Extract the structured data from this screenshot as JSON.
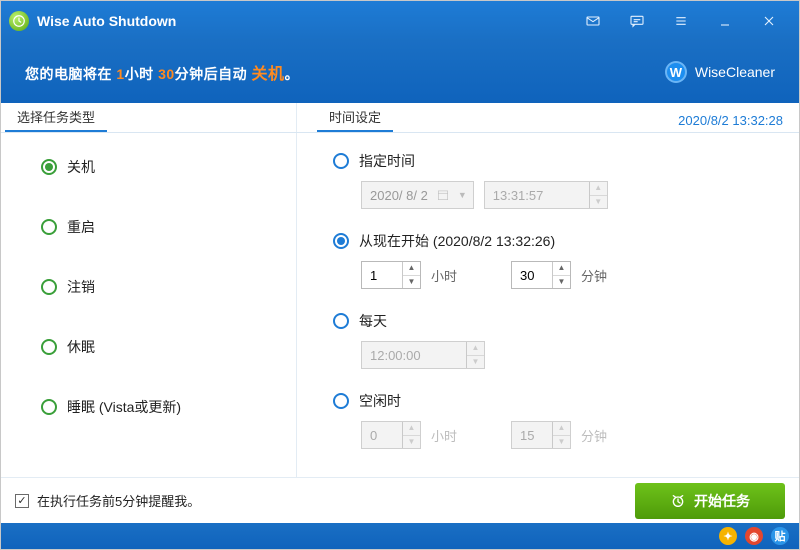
{
  "titlebar": {
    "title": "Wise Auto Shutdown"
  },
  "subheader": {
    "prefix": "您的电脑将在",
    "hours_num": "1",
    "hours_unit": "小时",
    "mins_num": "30",
    "mins_unit": "分钟后自动",
    "action": "关机",
    "suffix": "。",
    "brand": "WiseCleaner",
    "brand_letter": "W"
  },
  "sections": {
    "left": "选择任务类型",
    "right": "时间设定",
    "timestamp": "2020/8/2 13:32:28"
  },
  "tasks": {
    "items": [
      {
        "label": "关机",
        "selected": true
      },
      {
        "label": "重启",
        "selected": false
      },
      {
        "label": "注销",
        "selected": false
      },
      {
        "label": "休眠",
        "selected": false
      },
      {
        "label": "睡眠  (Vista或更新)",
        "selected": false
      }
    ]
  },
  "timing": {
    "specified": {
      "label": "指定时间",
      "date": "2020/ 8/ 2",
      "time": "13:31:57"
    },
    "from_now": {
      "label_prefix": "从现在开始 (",
      "now_ts": "2020/8/2 13:32:26",
      "label_suffix": ")",
      "hours_value": "1",
      "hours_label": "小时",
      "mins_value": "30",
      "mins_label": "分钟"
    },
    "daily": {
      "label": "每天",
      "time": "12:00:00"
    },
    "idle": {
      "label": "空闲时",
      "hours_value": "0",
      "hours_label": "小时",
      "mins_value": "15",
      "mins_label": "分钟"
    }
  },
  "footer": {
    "reminder_label": "在执行任务前5分钟提醒我。",
    "reminder_checked": true,
    "start_label": "开始任务"
  },
  "statusbar": {
    "badge3": "贴"
  }
}
